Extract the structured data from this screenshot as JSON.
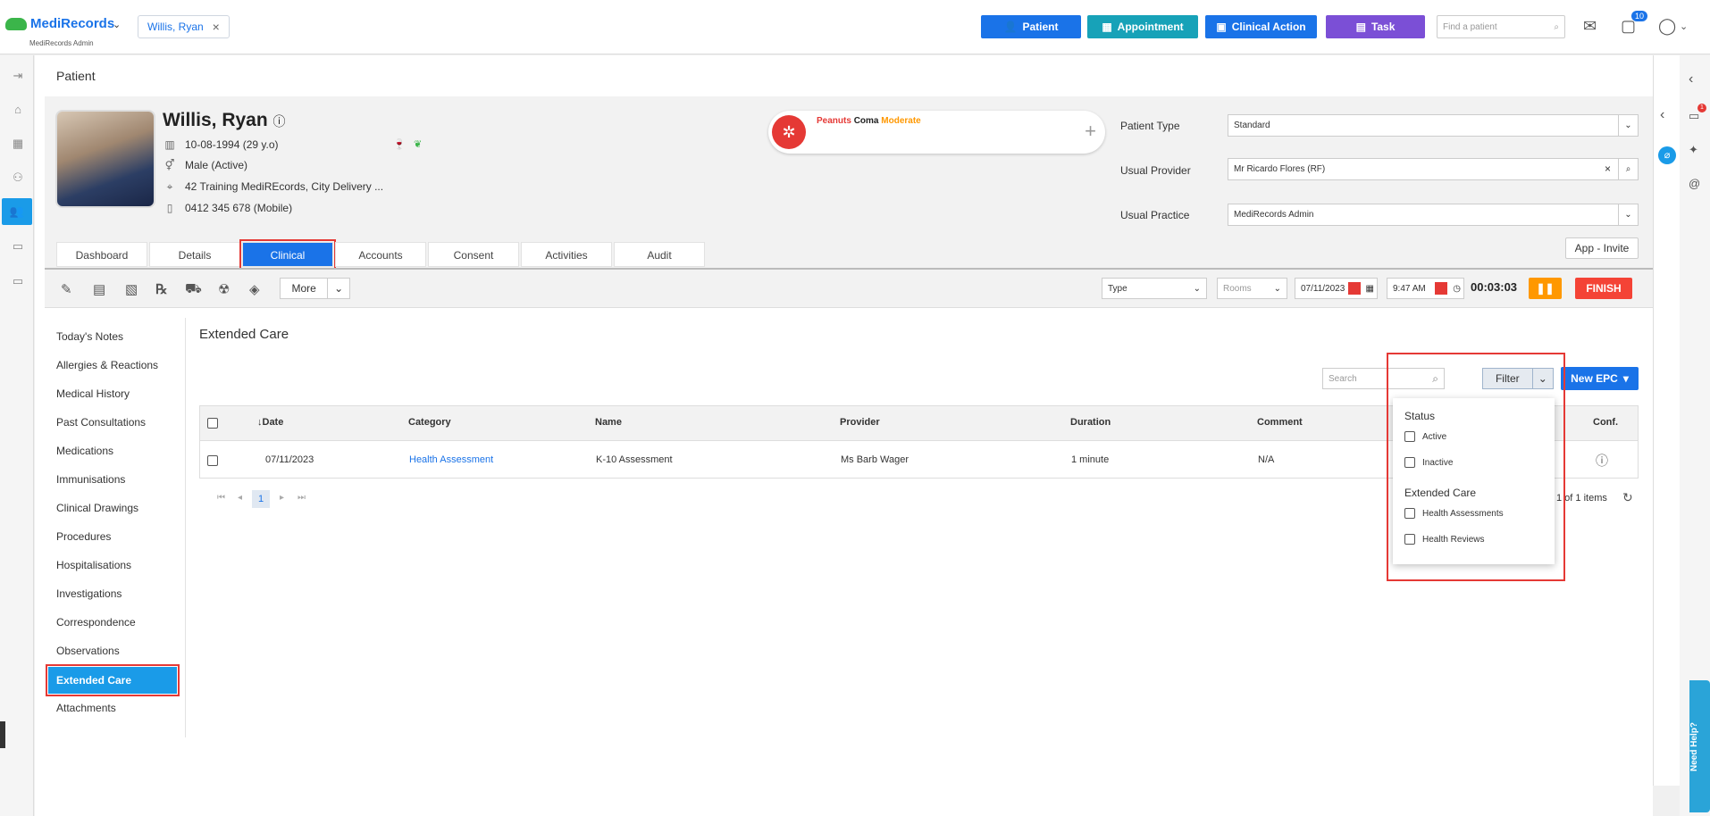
{
  "app": {
    "name": "MediRecords",
    "sub": "MediRecords Admin"
  },
  "open_patient_tab": "Willis, Ryan",
  "top_buttons": {
    "patient": "Patient",
    "appointment": "Appointment",
    "clinical_action": "Clinical Action",
    "task": "Task"
  },
  "find_patient_placeholder": "Find a patient",
  "task_badge": "10",
  "notif_badge": "1",
  "page_title": "Patient",
  "patient": {
    "name": "Willis, Ryan",
    "dob": "10-08-1994 (29 y.o)",
    "gender": "Male (Active)",
    "address": "42 Training MediREcords, City Delivery ...",
    "phone": "0412 345 678 (Mobile)"
  },
  "allergy": {
    "substance": "Peanuts",
    "reaction": "Coma",
    "severity": "Moderate"
  },
  "fields": {
    "patient_type_label": "Patient Type",
    "patient_type": "Standard",
    "usual_provider_label": "Usual Provider",
    "usual_provider": "Mr Ricardo Flores (RF)",
    "usual_practice_label": "Usual Practice",
    "usual_practice": "MediRecords Admin"
  },
  "app_invite": "App - Invite",
  "tabs": [
    "Dashboard",
    "Details",
    "Clinical",
    "Accounts",
    "Consent",
    "Activities",
    "Audit"
  ],
  "active_tab": "Clinical",
  "toolbar": {
    "more": "More",
    "type": "Type",
    "rooms": "Rooms",
    "date": "07/11/2023",
    "time": "9:47 AM",
    "timer": "00:03:03",
    "finish": "FINISH"
  },
  "sidenav": [
    "Today's Notes",
    "Allergies & Reactions",
    "Medical History",
    "Past Consultations",
    "Medications",
    "Immunisations",
    "Clinical Drawings",
    "Procedures",
    "Hospitalisations",
    "Investigations",
    "Correspondence",
    "Observations",
    "Extended Care",
    "Attachments"
  ],
  "active_nav": "Extended Care",
  "section_title": "Extended Care",
  "search_placeholder": "Search",
  "filter_label": "Filter",
  "new_epc": "New EPC",
  "table": {
    "headers": [
      "Date",
      "Category",
      "Name",
      "Provider",
      "Duration",
      "Comment",
      "Conf."
    ],
    "rows": [
      [
        "07/11/2023",
        "Health Assessment",
        "K-10 Assessment",
        "Ms Barb Wager",
        "1 minute",
        "N/A"
      ]
    ]
  },
  "pager": {
    "page": "1",
    "count": "1 of 1 items"
  },
  "filter_menu": {
    "status_heading": "Status",
    "active": "Active",
    "inactive": "Inactive",
    "ec_heading": "Extended Care",
    "health_assessments": "Health Assessments",
    "health_reviews": "Health Reviews"
  },
  "need_help": "Need Help?",
  "colors": {
    "primary": "#1a73e8",
    "teal": "#17a2b8",
    "purple": "#7b4fd6",
    "finish": "#f44336",
    "pause": "#ff9800",
    "highlight": "#e53935"
  }
}
